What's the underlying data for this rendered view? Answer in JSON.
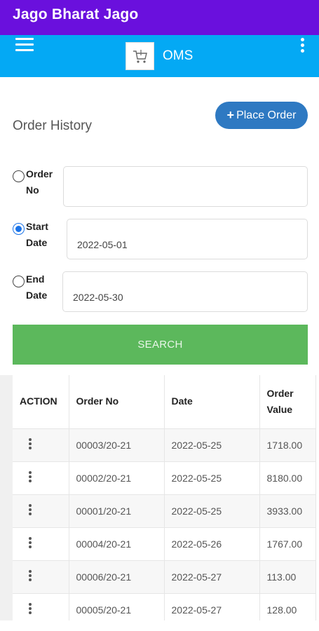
{
  "app_title": "Jago Bharat Jago",
  "toolbar": {
    "brand": "OMS",
    "menu_icon": "hamburger-icon",
    "more_icon": "more-vert-icon"
  },
  "page": {
    "title": "Order History",
    "place_order_label": "Place Order"
  },
  "filters": {
    "order_no_label": "Order No",
    "order_no_value": "",
    "start_date_label": "Start Date",
    "start_date_value": "2022-05-01",
    "end_date_label": "End Date",
    "end_date_value": "2022-05-30",
    "selected": "start_date",
    "search_label": "SEARCH"
  },
  "table": {
    "headers": [
      "ACTION",
      "Order No",
      "Date",
      "Order Value"
    ],
    "rows": [
      {
        "order_no": "00003/20-21",
        "date": "2022-05-25",
        "value": "1718.00"
      },
      {
        "order_no": "00002/20-21",
        "date": "2022-05-25",
        "value": "8180.00"
      },
      {
        "order_no": "00001/20-21",
        "date": "2022-05-25",
        "value": "3933.00"
      },
      {
        "order_no": "00004/20-21",
        "date": "2022-05-26",
        "value": "1767.00"
      },
      {
        "order_no": "00006/20-21",
        "date": "2022-05-27",
        "value": "113.00"
      },
      {
        "order_no": "00005/20-21",
        "date": "2022-05-27",
        "value": "128.00"
      }
    ]
  },
  "colors": {
    "titlebar": "#6a10dd",
    "toolbar": "#04a9f4",
    "place_order": "#2e79c2",
    "search": "#5cb85c",
    "radio_selected": "#1a73e8"
  }
}
